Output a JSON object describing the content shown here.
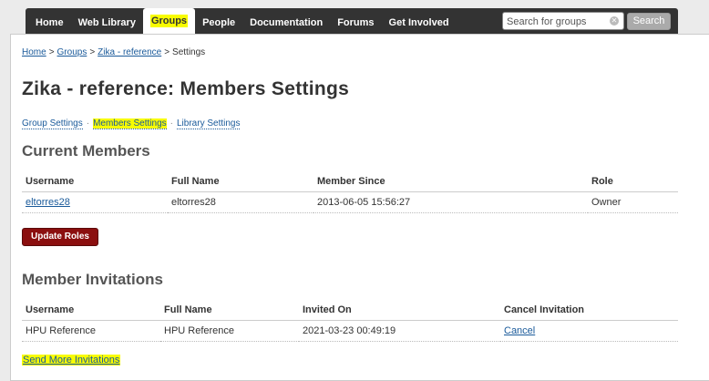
{
  "nav": {
    "items": [
      "Home",
      "Web Library",
      "Groups",
      "People",
      "Documentation",
      "Forums",
      "Get Involved"
    ],
    "active_index": 2,
    "search_placeholder": "Search for groups",
    "search_button": "Search"
  },
  "breadcrumb": {
    "home": "Home",
    "groups": "Groups",
    "group": "Zika - reference",
    "current": "Settings",
    "separator": ">"
  },
  "page_title": "Zika - reference: Members Settings",
  "subnav": {
    "group_settings": "Group Settings",
    "members_settings": "Members Settings",
    "library_settings": "Library Settings",
    "dot": "·"
  },
  "current_members": {
    "heading": "Current Members",
    "columns": [
      "Username",
      "Full Name",
      "Member Since",
      "Role"
    ],
    "rows": [
      {
        "username": "eltorres28",
        "full_name": "eltorres28",
        "member_since": "2013-06-05 15:56:27",
        "role": "Owner"
      }
    ],
    "update_button": "Update Roles"
  },
  "invitations": {
    "heading": "Member Invitations",
    "columns": [
      "Username",
      "Full Name",
      "Invited On",
      "Cancel Invitation"
    ],
    "rows": [
      {
        "username": "HPU Reference",
        "full_name": "HPU Reference",
        "invited_on": "2021-03-23 00:49:19",
        "cancel": "Cancel"
      }
    ],
    "send_more": "Send More Invitations"
  },
  "colors": {
    "highlight": "#f8fc00",
    "link": "#1a5a9a",
    "nav_bg": "#333333",
    "update_button_bg": "#8b0f0f"
  }
}
